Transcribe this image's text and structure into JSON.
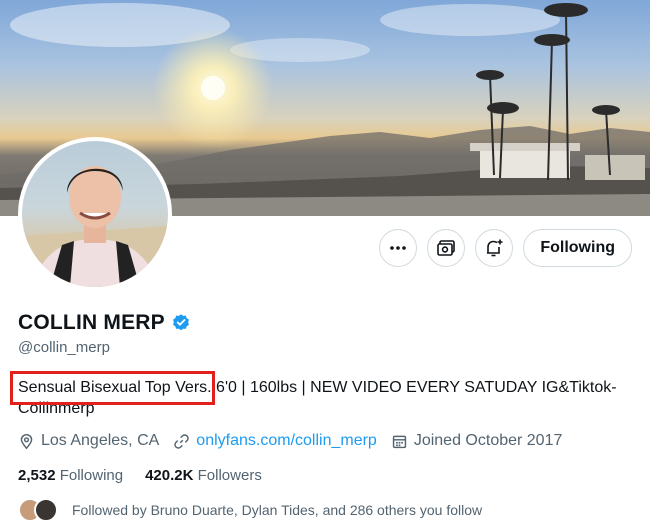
{
  "profile": {
    "display_name": "COLLIN MERP",
    "handle": "@collin_merp",
    "bio": "Sensual Bisexual Top Vers. 6'0 | 160lbs | NEW VIDEO EVERY SATUDAY IG&Tiktok- Collinmerp",
    "location": "Los Angeles, CA",
    "website": "onlyfans.com/collin_merp",
    "joined": "Joined October 2017"
  },
  "actions": {
    "more_icon": "ellipsis-icon",
    "subscriptions_icon": "money-icon",
    "notify_icon": "bell-plus-icon",
    "following_label": "Following"
  },
  "stats": {
    "following_count": "2,532",
    "following_label": "Following",
    "followers_count": "420.2K",
    "followers_label": "Followers"
  },
  "followed_by": {
    "text": "Followed by Bruno Duarte, Dylan Tides, and 286 others you follow"
  },
  "colors": {
    "accent": "#1d9bf0",
    "highlight_box": "#e2201c",
    "secondary_text": "#536471"
  }
}
